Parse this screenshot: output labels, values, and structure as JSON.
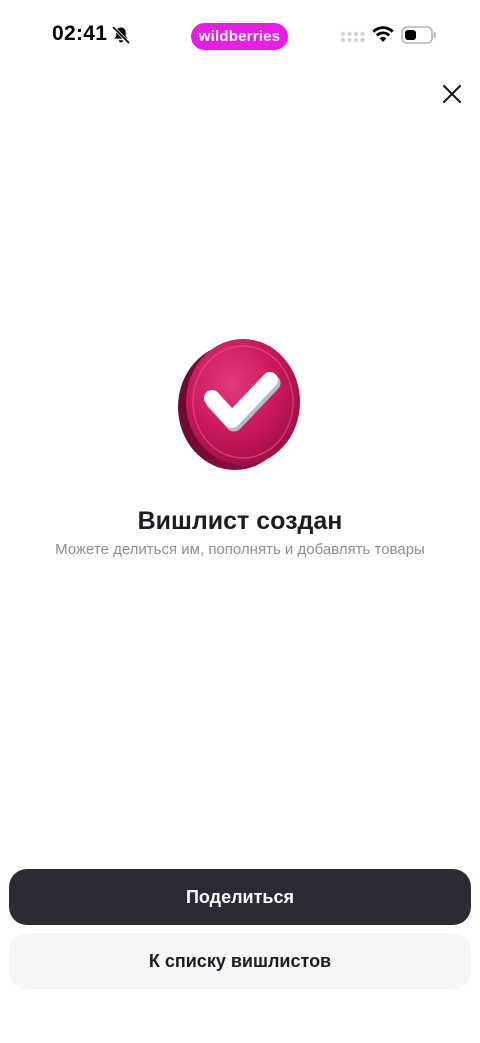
{
  "status_bar": {
    "time": "02:41",
    "brand": "wildberries",
    "brand_color": "#e91ee6",
    "icons": [
      "bell-off-icon",
      "signal-icon",
      "wifi-icon",
      "battery-icon"
    ]
  },
  "header": {
    "close_icon": "close-icon"
  },
  "hero": {
    "badge_icon": "checkmark-coin-icon",
    "badge_color": "#c8175a",
    "title": "Вишлист создан",
    "subtitle": "Можете делиться им, пополнять и добавлять товары"
  },
  "actions": {
    "share_label": "Поделиться",
    "to_list_label": "К списку вишлистов"
  }
}
